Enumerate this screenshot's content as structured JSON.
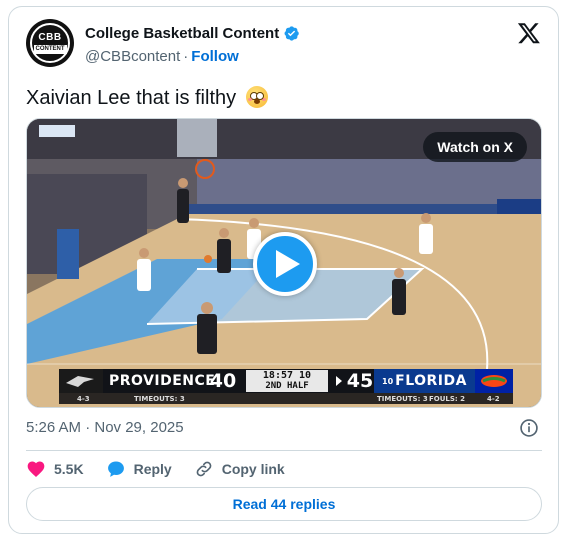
{
  "author": {
    "display_name": "College Basketball Content",
    "handle": "@CBBcontent",
    "separator": "·",
    "follow_label": "Follow",
    "avatar_text_top": "CBB",
    "avatar_text_bottom": "CONTENT"
  },
  "tweet": {
    "text": "Xaivian Lee that is filthy",
    "emoji": "flushed-face-emoji"
  },
  "media": {
    "watch_label": "Watch on X",
    "scoreboard": {
      "left_team": "PROVIDENCE",
      "left_score": "40",
      "left_record": "4-3",
      "left_timeouts": "TIMEOUTS: 3",
      "clock": "18:57 10",
      "period": "2ND HALF",
      "right_score": "45",
      "right_rank": "10",
      "right_team": "FLORIDA",
      "right_timeouts": "TIMEOUTS: 3",
      "right_fouls": "FOULS: 2",
      "right_record": "4-2"
    }
  },
  "meta": {
    "timestamp": "5:26 AM · Nov 29, 2025"
  },
  "actions": {
    "like_count": "5.5K",
    "reply_label": "Reply",
    "copy_label": "Copy link"
  },
  "read_replies_label": "Read 44 replies",
  "colors": {
    "link": "#006fd6",
    "like": "#f91880",
    "reply_icon": "#1d9bf0",
    "muted": "#536471",
    "border": "#cfd9de"
  }
}
